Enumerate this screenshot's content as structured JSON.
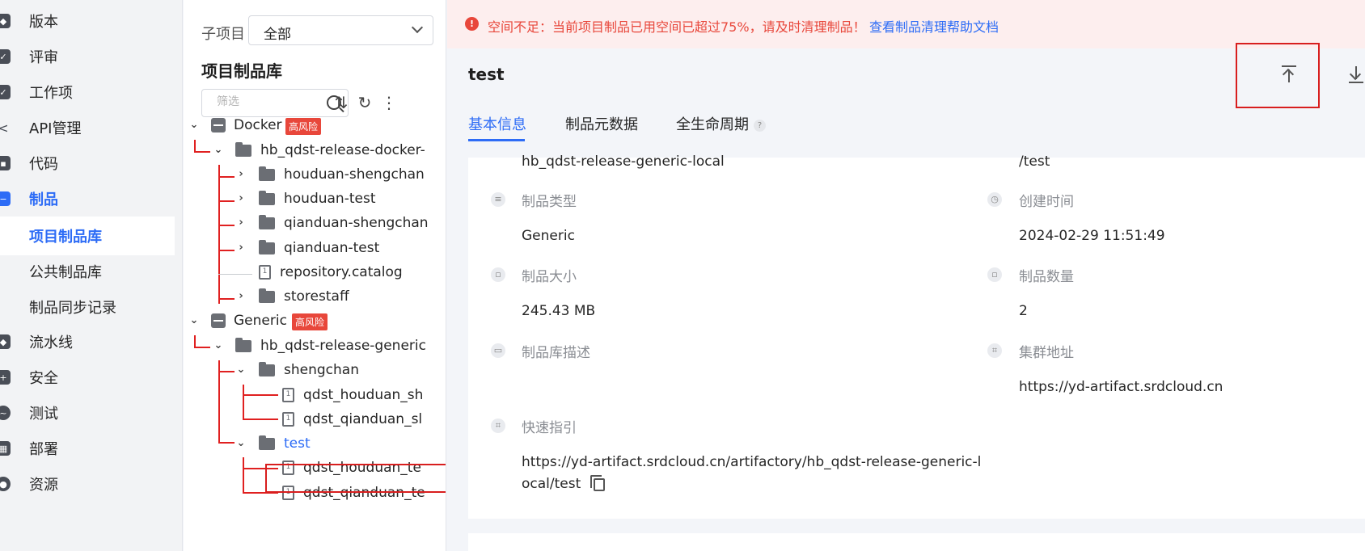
{
  "nav": {
    "items": [
      {
        "label": "版本",
        "icon": "tag-icon"
      },
      {
        "label": "评审",
        "icon": "review-icon"
      },
      {
        "label": "工作项",
        "icon": "task-icon"
      },
      {
        "label": "API管理",
        "icon": "share-icon"
      },
      {
        "label": "代码",
        "icon": "code-icon"
      },
      {
        "label": "制品",
        "icon": "package-icon"
      },
      {
        "label": "流水线",
        "icon": "pipeline-icon"
      },
      {
        "label": "安全",
        "icon": "shield-icon"
      },
      {
        "label": "测试",
        "icon": "test-icon"
      },
      {
        "label": "部署",
        "icon": "deploy-icon"
      },
      {
        "label": "资源",
        "icon": "resource-icon"
      }
    ],
    "subitems": [
      {
        "label": "项目制品库"
      },
      {
        "label": "公共制品库"
      },
      {
        "label": "制品同步记录"
      }
    ]
  },
  "tree": {
    "sub_label": "子项目",
    "sub_value": "全部",
    "title": "项目制品库",
    "filter_placeholder": "筛选",
    "risk_badge": "高风险",
    "rows": [
      {
        "label": "Docker"
      },
      {
        "label": "hb_qdst-release-docker-"
      },
      {
        "label": "houduan-shengchan"
      },
      {
        "label": "houduan-test"
      },
      {
        "label": "qianduan-shengchan"
      },
      {
        "label": "qianduan-test"
      },
      {
        "label": "repository.catalog"
      },
      {
        "label": "storestaff"
      },
      {
        "label": "Generic"
      },
      {
        "label": "hb_qdst-release-generic"
      },
      {
        "label": "shengchan"
      },
      {
        "label": "qdst_houduan_sh"
      },
      {
        "label": "qdst_qianduan_sl"
      },
      {
        "label": "test"
      },
      {
        "label": "qdst_houduan_te"
      },
      {
        "label": "qdst_qianduan_te"
      }
    ]
  },
  "alert": {
    "text": "空间不足：当前项目制品已用空间已超过75%，请及时清理制品！",
    "link": "查看制品清理帮助文档",
    "color": "#e8473b"
  },
  "main": {
    "title": "test",
    "tabs": [
      "基本信息",
      "制品元数据",
      "全生命周期"
    ],
    "fields": {
      "repo_value": "hb_qdst-release-generic-local",
      "path_value": "/test",
      "type_label": "制品类型",
      "type_value": "Generic",
      "created_label": "创建时间",
      "created_value": "2024-02-29 11:51:49",
      "size_label": "制品大小",
      "size_value": "245.43 MB",
      "count_label": "制品数量",
      "count_value": "2",
      "desc_label": "制品库描述",
      "cluster_label": "集群地址",
      "cluster_value": "https://yd-artifact.srdcloud.cn",
      "guide_label": "快速指引",
      "guide_line1": "https://yd-artifact.srdcloud.cn/artifactory/hb_qdst-release-generic-l",
      "guide_line2": "ocal/test"
    }
  },
  "accent": "#2d6cf6"
}
